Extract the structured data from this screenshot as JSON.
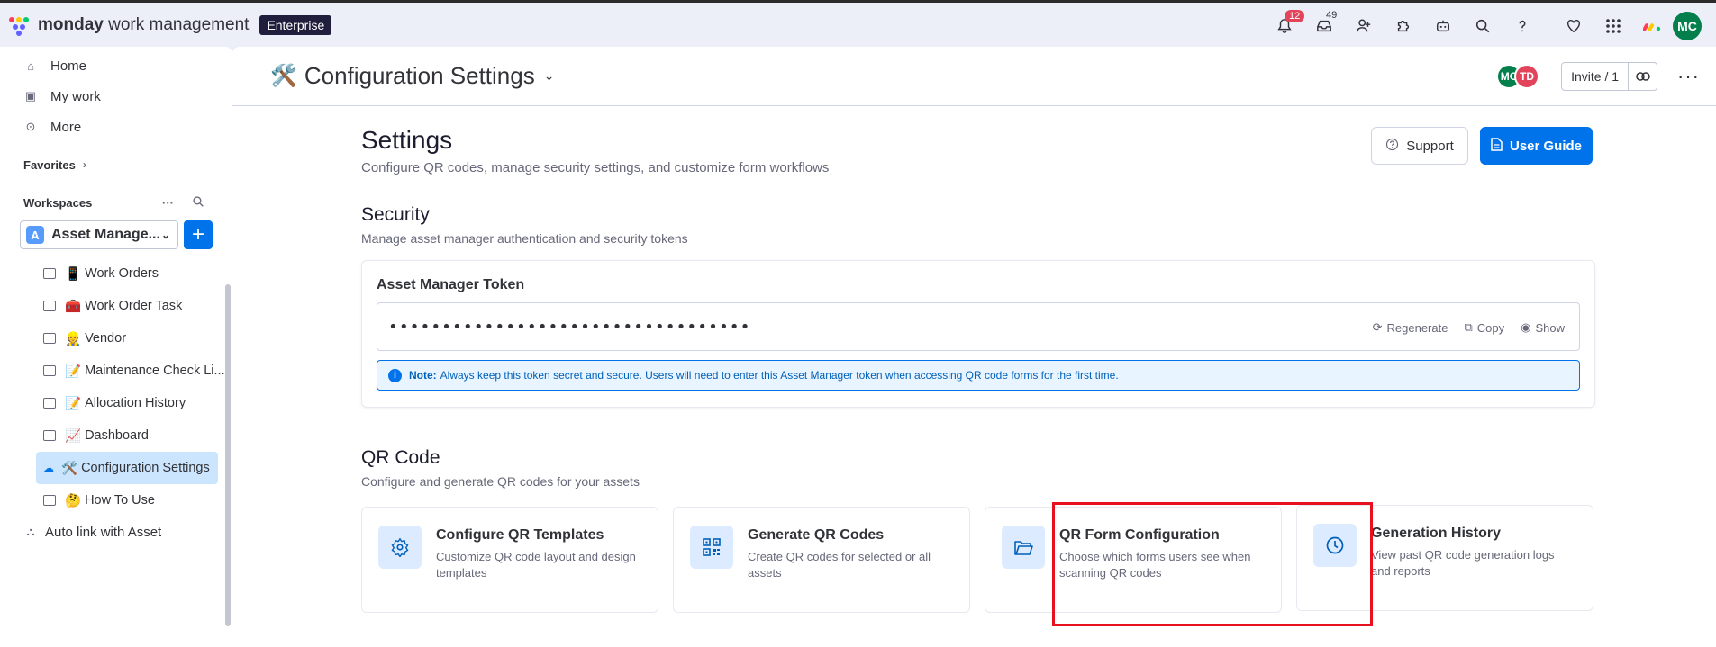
{
  "topbar": {
    "brand_bold": "monday",
    "brand_rest": " work management",
    "plan": "Enterprise",
    "notifications_count": "12",
    "inbox_count": "49",
    "user_initials": "MC"
  },
  "sidebar": {
    "nav": [
      {
        "label": "Home"
      },
      {
        "label": "My work"
      },
      {
        "label": "More"
      }
    ],
    "favorites": "Favorites",
    "workspaces": "Workspaces",
    "workspace_letter": "A",
    "workspace_name": "Asset Manage...",
    "boards": [
      {
        "emoji": "📱",
        "label": "Work Orders"
      },
      {
        "emoji": "🧰",
        "label": "Work Order Task"
      },
      {
        "emoji": "👷",
        "label": "Vendor"
      },
      {
        "emoji": "📝",
        "label": "Maintenance Check Li..."
      },
      {
        "emoji": "📝",
        "label": "Allocation History"
      },
      {
        "emoji": "📈",
        "label": "Dashboard"
      },
      {
        "emoji": "🛠️",
        "label": "Configuration Settings"
      },
      {
        "emoji": "🤔",
        "label": "How To Use"
      }
    ],
    "auto_link": "Auto link with Asset"
  },
  "header": {
    "title": "Configuration Settings",
    "emoji": "🛠️",
    "avatars": [
      "MC",
      "TD"
    ],
    "invite": "Invite / 1"
  },
  "settings": {
    "title": "Settings",
    "subtitle": "Configure QR codes, manage security settings, and customize form workflows",
    "support": "Support",
    "user_guide": "User Guide"
  },
  "security": {
    "title": "Security",
    "subtitle": "Manage asset manager authentication and security tokens",
    "card_title": "Asset Manager Token",
    "token_value": "••••••••••••••••••••••••••••••••••",
    "regenerate": "Regenerate",
    "copy": "Copy",
    "show": "Show",
    "note_label": "Note:",
    "note_text": "Always keep this token secret and secure. Users will need to enter this Asset Manager token when accessing QR code forms for the first time."
  },
  "qr": {
    "title": "QR Code",
    "subtitle": "Configure and generate QR codes for your assets",
    "cards": [
      {
        "title": "Configure QR Templates",
        "desc": "Customize QR code layout and design templates",
        "icon": "gear-icon"
      },
      {
        "title": "Generate QR Codes",
        "desc": "Create QR codes for selected or all assets",
        "icon": "qr-icon"
      },
      {
        "title": "QR Form Configuration",
        "desc": "Choose which forms users see when scanning QR codes",
        "icon": "folder-icon"
      },
      {
        "title": "Generation History",
        "desc": "View past QR code generation logs and reports",
        "icon": "clock-icon"
      }
    ]
  },
  "colors": {
    "accent": "#0073ea",
    "highlight": "#e8101e"
  }
}
